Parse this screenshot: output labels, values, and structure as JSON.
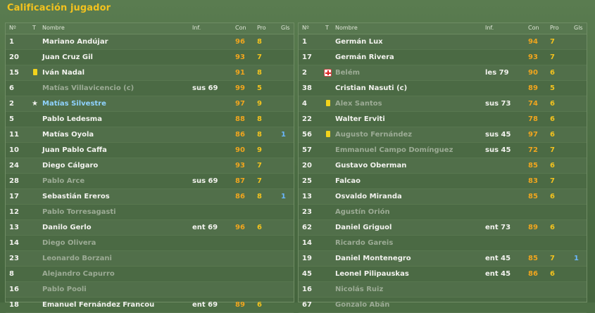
{
  "title": "Calificación jugador",
  "headers": {
    "num": "Nº",
    "t": "T",
    "name": "Nombre",
    "inf": "Inf.",
    "con": "Con",
    "pro": "Pro",
    "gls": "Gls"
  },
  "colors": {
    "background": "#4d6e45",
    "title": "#f2c21e",
    "con": "#f0a51e",
    "pro": "#f2c21e",
    "goals": "#6ab6ff",
    "substitute_text": "#9cab95"
  },
  "left_team": [
    {
      "num": "1",
      "name": "Mariano Andújar",
      "inf": "",
      "con": "96",
      "pro": "8",
      "gls": "",
      "icon": "",
      "style": ""
    },
    {
      "num": "20",
      "name": "Juan Cruz Gil",
      "inf": "",
      "con": "93",
      "pro": "7",
      "gls": "",
      "icon": "",
      "style": ""
    },
    {
      "num": "15",
      "name": "Iván Nadal",
      "inf": "",
      "con": "91",
      "pro": "8",
      "gls": "",
      "icon": "yellow-card-icon",
      "style": ""
    },
    {
      "num": "6",
      "name": "Matías Villavicencio (c)",
      "inf": "sus 69",
      "con": "99",
      "pro": "5",
      "gls": "",
      "icon": "",
      "style": "sub"
    },
    {
      "num": "2",
      "name": "Matías Silvestre",
      "inf": "",
      "con": "97",
      "pro": "9",
      "gls": "",
      "icon": "star-icon",
      "style": "hl"
    },
    {
      "num": "5",
      "name": "Pablo Ledesma",
      "inf": "",
      "con": "88",
      "pro": "8",
      "gls": "",
      "icon": "",
      "style": ""
    },
    {
      "num": "11",
      "name": "Matías Oyola",
      "inf": "",
      "con": "86",
      "pro": "8",
      "gls": "1",
      "icon": "",
      "style": ""
    },
    {
      "num": "10",
      "name": "Juan Pablo Caffa",
      "inf": "",
      "con": "90",
      "pro": "9",
      "gls": "",
      "icon": "",
      "style": ""
    },
    {
      "num": "24",
      "name": "Diego Cálgaro",
      "inf": "",
      "con": "93",
      "pro": "7",
      "gls": "",
      "icon": "",
      "style": ""
    },
    {
      "num": "28",
      "name": "Pablo Arce",
      "inf": "sus 69",
      "con": "87",
      "pro": "7",
      "gls": "",
      "icon": "",
      "style": "sub"
    },
    {
      "num": "17",
      "name": "Sebastián Ereros",
      "inf": "",
      "con": "86",
      "pro": "8",
      "gls": "1",
      "icon": "",
      "style": ""
    },
    {
      "num": "12",
      "name": "Pablo Torresagasti",
      "inf": "",
      "con": "",
      "pro": "",
      "gls": "",
      "icon": "",
      "style": "sub"
    },
    {
      "num": "13",
      "name": "Danilo Gerlo",
      "inf": "ent 69",
      "con": "96",
      "pro": "6",
      "gls": "",
      "icon": "",
      "style": ""
    },
    {
      "num": "14",
      "name": "Diego Olivera",
      "inf": "",
      "con": "",
      "pro": "",
      "gls": "",
      "icon": "",
      "style": "sub"
    },
    {
      "num": "23",
      "name": "Leonardo Borzani",
      "inf": "",
      "con": "",
      "pro": "",
      "gls": "",
      "icon": "",
      "style": "sub"
    },
    {
      "num": "8",
      "name": "Alejandro Capurro",
      "inf": "",
      "con": "",
      "pro": "",
      "gls": "",
      "icon": "",
      "style": "sub"
    },
    {
      "num": "16",
      "name": "Pablo Pooli",
      "inf": "",
      "con": "",
      "pro": "",
      "gls": "",
      "icon": "",
      "style": "sub"
    },
    {
      "num": "18",
      "name": "Emanuel Fernández Francou",
      "inf": "ent 69",
      "con": "89",
      "pro": "6",
      "gls": "",
      "icon": "",
      "style": ""
    }
  ],
  "right_team": [
    {
      "num": "1",
      "name": "Germán Lux",
      "inf": "",
      "con": "94",
      "pro": "7",
      "gls": "",
      "icon": "",
      "style": ""
    },
    {
      "num": "17",
      "name": "Germán Rivera",
      "inf": "",
      "con": "93",
      "pro": "7",
      "gls": "",
      "icon": "",
      "style": ""
    },
    {
      "num": "2",
      "name": "Belém",
      "inf": "les 79",
      "con": "90",
      "pro": "6",
      "gls": "",
      "icon": "injury-icon",
      "style": "sub"
    },
    {
      "num": "38",
      "name": "Cristian Nasuti (c)",
      "inf": "",
      "con": "89",
      "pro": "5",
      "gls": "",
      "icon": "",
      "style": ""
    },
    {
      "num": "4",
      "name": "Alex Santos",
      "inf": "sus 73",
      "con": "74",
      "pro": "6",
      "gls": "",
      "icon": "yellow-card-icon",
      "style": "sub"
    },
    {
      "num": "22",
      "name": "Walter Erviti",
      "inf": "",
      "con": "78",
      "pro": "6",
      "gls": "",
      "icon": "",
      "style": ""
    },
    {
      "num": "56",
      "name": "Augusto Fernández",
      "inf": "sus 45",
      "con": "97",
      "pro": "6",
      "gls": "",
      "icon": "yellow-card-icon",
      "style": "sub"
    },
    {
      "num": "57",
      "name": "Emmanuel Campo Domínguez",
      "inf": "sus 45",
      "con": "72",
      "pro": "7",
      "gls": "",
      "icon": "",
      "style": "sub"
    },
    {
      "num": "20",
      "name": "Gustavo Oberman",
      "inf": "",
      "con": "85",
      "pro": "6",
      "gls": "",
      "icon": "",
      "style": ""
    },
    {
      "num": "25",
      "name": "Falcao",
      "inf": "",
      "con": "83",
      "pro": "7",
      "gls": "",
      "icon": "",
      "style": ""
    },
    {
      "num": "13",
      "name": "Osvaldo Miranda",
      "inf": "",
      "con": "85",
      "pro": "6",
      "gls": "",
      "icon": "",
      "style": ""
    },
    {
      "num": "23",
      "name": "Agustín Orión",
      "inf": "",
      "con": "",
      "pro": "",
      "gls": "",
      "icon": "",
      "style": "sub"
    },
    {
      "num": "62",
      "name": "Daniel Griguol",
      "inf": "ent 73",
      "con": "89",
      "pro": "6",
      "gls": "",
      "icon": "",
      "style": ""
    },
    {
      "num": "14",
      "name": "Ricardo Gareis",
      "inf": "",
      "con": "",
      "pro": "",
      "gls": "",
      "icon": "",
      "style": "sub"
    },
    {
      "num": "19",
      "name": "Daniel Montenegro",
      "inf": "ent 45",
      "con": "85",
      "pro": "7",
      "gls": "1",
      "icon": "",
      "style": ""
    },
    {
      "num": "45",
      "name": "Leonel Pilipauskas",
      "inf": "ent 45",
      "con": "86",
      "pro": "6",
      "gls": "",
      "icon": "",
      "style": ""
    },
    {
      "num": "16",
      "name": "Nicolás Ruiz",
      "inf": "",
      "con": "",
      "pro": "",
      "gls": "",
      "icon": "",
      "style": "sub"
    },
    {
      "num": "67",
      "name": "Gonzalo Abán",
      "inf": "",
      "con": "",
      "pro": "",
      "gls": "",
      "icon": "",
      "style": "sub"
    }
  ]
}
